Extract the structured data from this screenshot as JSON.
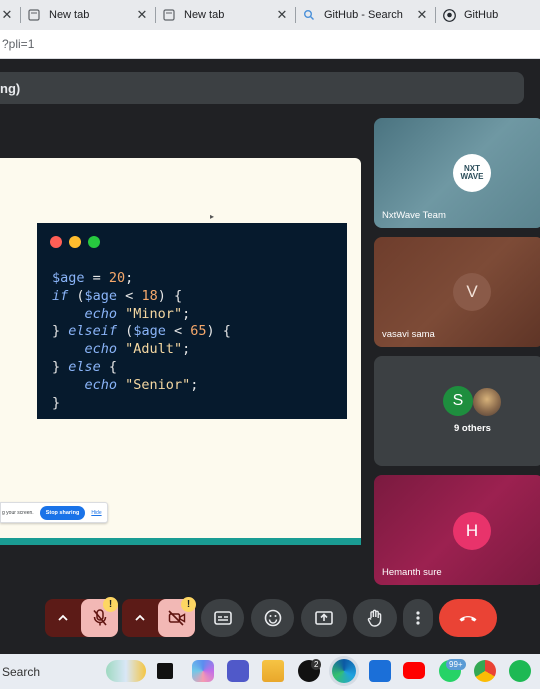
{
  "browser": {
    "tabs": [
      {
        "label": "New tab",
        "icon": "page-icon"
      },
      {
        "label": "New tab",
        "icon": "page-icon"
      },
      {
        "label": "GitHub - Search",
        "icon": "search-icon"
      },
      {
        "label": "GitHub",
        "icon": "github-icon"
      }
    ],
    "address": "?pli=1"
  },
  "meet": {
    "title_fragment": "ng)",
    "slide": {
      "code_lines": [
        {
          "parts": [
            [
              "var",
              "$age"
            ],
            [
              "plain",
              " = "
            ],
            [
              "num",
              "20"
            ],
            [
              "plain",
              ";"
            ]
          ]
        },
        {
          "parts": [
            [
              "kw",
              "if"
            ],
            [
              "plain",
              " ("
            ],
            [
              "var",
              "$age"
            ],
            [
              "plain",
              " < "
            ],
            [
              "num",
              "18"
            ],
            [
              "plain",
              ") {"
            ]
          ]
        },
        {
          "parts": [
            [
              "plain",
              "    "
            ],
            [
              "kw",
              "echo"
            ],
            [
              "plain",
              " "
            ],
            [
              "str",
              "\"Minor\""
            ],
            [
              "plain",
              ";"
            ]
          ]
        },
        {
          "parts": [
            [
              "plain",
              "} "
            ],
            [
              "kw",
              "elseif"
            ],
            [
              "plain",
              " ("
            ],
            [
              "var",
              "$age"
            ],
            [
              "plain",
              " < "
            ],
            [
              "num",
              "65"
            ],
            [
              "plain",
              ") {"
            ]
          ]
        },
        {
          "parts": [
            [
              "plain",
              "    "
            ],
            [
              "kw",
              "echo"
            ],
            [
              "plain",
              " "
            ],
            [
              "str",
              "\"Adult\""
            ],
            [
              "plain",
              ";"
            ]
          ]
        },
        {
          "parts": [
            [
              "plain",
              "} "
            ],
            [
              "kw",
              "else"
            ],
            [
              "plain",
              " {"
            ]
          ]
        },
        {
          "parts": [
            [
              "plain",
              "    "
            ],
            [
              "kw",
              "echo"
            ],
            [
              "plain",
              " "
            ],
            [
              "str",
              "\"Senior\""
            ],
            [
              "plain",
              ";"
            ]
          ]
        },
        {
          "parts": [
            [
              "plain",
              "}"
            ]
          ]
        }
      ],
      "window_dots": [
        "#ff5f56",
        "#ffbd2e",
        "#27c93f"
      ]
    },
    "share_bar": {
      "text": "g your screen.",
      "stop_label": "Stop sharing",
      "hide_label": "Hide"
    },
    "participants": [
      {
        "name": "NxtWave Team",
        "logo_text": [
          "NXT",
          "WAVE"
        ]
      },
      {
        "name": "vasavi sama",
        "initial": "V"
      },
      {
        "name": "",
        "initial": "S",
        "others_label": "9 others"
      },
      {
        "name": "Hemanth sure",
        "initial": "H"
      }
    ],
    "warning_mark": "!"
  },
  "taskbar": {
    "search_label": "Search",
    "x_badge": "2",
    "whatsapp_badge": "99+"
  },
  "colors": {
    "end_call": "#ea4335",
    "mic_off_bg": "#5c1b17",
    "accent": "#1a73e8"
  }
}
